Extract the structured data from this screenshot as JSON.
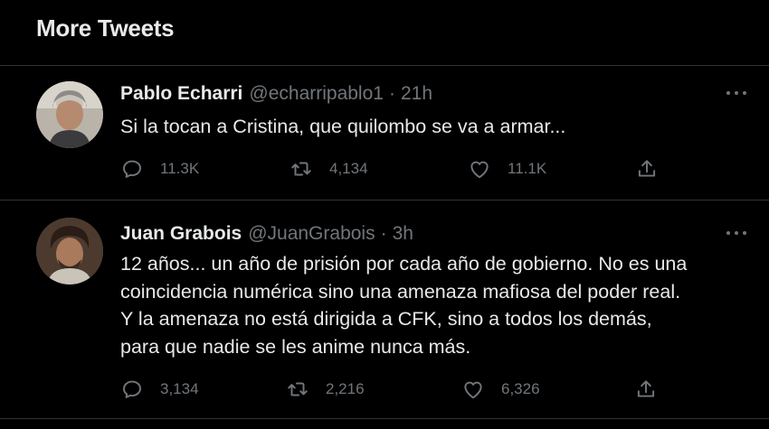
{
  "section": {
    "title": "More Tweets"
  },
  "tweets": [
    {
      "name": "Pablo Echarri",
      "handle": "@echarripablo1",
      "separator": "·",
      "time": "21h",
      "text_lines": [
        "Si la tocan a Cristina, que quilombo se va a armar..."
      ],
      "replies": "11.3K",
      "retweets": "4,134",
      "likes": "11.1K"
    },
    {
      "name": "Juan Grabois",
      "handle": "@JuanGrabois",
      "separator": "·",
      "time": "3h",
      "text_lines": [
        "12 años... un año de prisión por cada año de gobierno. No es una",
        "coincidencia numérica sino una amenaza mafiosa del poder real.",
        "Y la amenaza no está dirigida a CFK, sino a todos los demás,",
        "para que nadie se les anime nunca más."
      ],
      "replies": "3,134",
      "retweets": "2,216",
      "likes": "6,326"
    }
  ],
  "icons": {
    "reply": "reply-icon",
    "retweet": "retweet-icon",
    "like": "heart-icon",
    "share": "share-icon",
    "more": "more-icon"
  },
  "colors": {
    "background": "#000000",
    "text": "#e7e9ea",
    "secondary": "#71767b",
    "divider": "#2f3336"
  }
}
